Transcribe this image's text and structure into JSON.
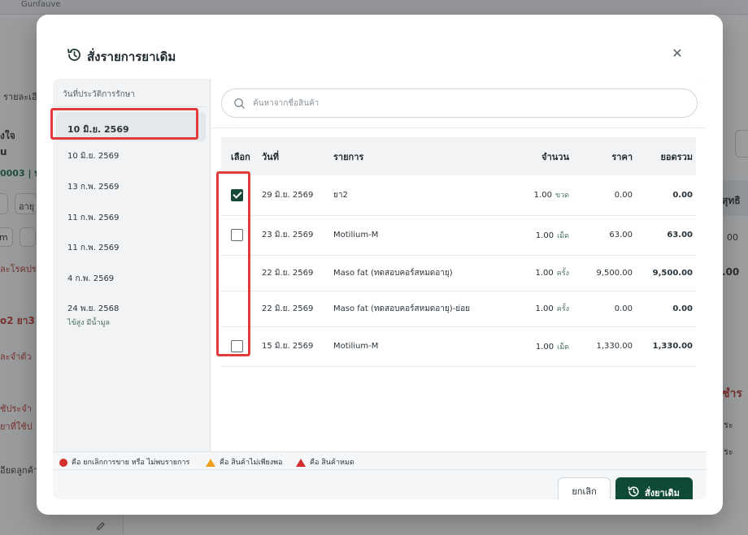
{
  "background": {
    "top_text": "Gunfauve",
    "left_fragments": [
      "รายละเอี",
      "งใจ",
      "u",
      "0003 | ท",
      "อายุ",
      "m",
      "ละโรคประ",
      "o2 ยา3",
      "ละจำตัว",
      "ชัประจำ",
      "ยาที่ใช้ป",
      "อียดลูกค้า"
    ],
    "right_fragments": [
      "สุทธิ",
      "00",
      ".00",
      "ชำร",
      "ระ",
      "ระ"
    ]
  },
  "modal": {
    "title": "สั่งรายการยาเดิม",
    "title_icon": "history-icon",
    "close_icon": "close-icon",
    "close_glyph": "✕"
  },
  "history_panel": {
    "title": "วันที่ประวัติการรักษา",
    "items": [
      {
        "date": "10 มิ.ย. 2569",
        "note": "",
        "active": true
      },
      {
        "date": "10 มิ.ย. 2569",
        "note": "",
        "active": false
      },
      {
        "date": "13 ก.พ. 2569",
        "note": "",
        "active": false
      },
      {
        "date": "11 ก.พ. 2569",
        "note": "",
        "active": false
      },
      {
        "date": "11 ก.พ. 2569",
        "note": "",
        "active": false
      },
      {
        "date": "4 ก.พ. 2569",
        "note": "",
        "active": false
      },
      {
        "date": "24 พ.ย. 2568",
        "note": "ไข้สูง มีน้ำมูล",
        "active": false
      }
    ]
  },
  "search": {
    "placeholder": "ค้นหาจากชื่อสินค้า",
    "value": ""
  },
  "table": {
    "headers": {
      "select": "เลือก",
      "date": "วันที่",
      "item": "รายการ",
      "qty": "จำนวน",
      "price": "ราคา",
      "total": "ยอดรวม"
    },
    "rows": [
      {
        "checkbox": "checked",
        "date": "29 มิ.ย. 2569",
        "item": "ยา2",
        "qty": "1.00",
        "unit": "ขวด",
        "price": "0.00",
        "total": "0.00"
      },
      {
        "checkbox": "unchecked",
        "date": "23 มิ.ย. 2569",
        "item": "Motilium-M",
        "qty": "1.00",
        "unit": "เม็ด",
        "price": "63.00",
        "total": "63.00"
      },
      {
        "checkbox": "none",
        "date": "22 มิ.ย. 2569",
        "item": "Maso fat (ทดสอบคอร์สหมดอายุ)",
        "qty": "1.00",
        "unit": "ครั้ง",
        "price": "9,500.00",
        "total": "9,500.00"
      },
      {
        "checkbox": "none",
        "date": "22 มิ.ย. 2569",
        "item": "Maso fat (ทดสอบคอร์สหมดอายุ)-ย่อย",
        "qty": "1.00",
        "unit": "ครั้ง",
        "price": "0.00",
        "total": "0.00"
      },
      {
        "checkbox": "unchecked",
        "date": "15 มิ.ย. 2569",
        "item": "Motilium-M",
        "qty": "1.00",
        "unit": "เม็ด",
        "price": "1,330.00",
        "total": "1,330.00"
      }
    ]
  },
  "legend": [
    {
      "icon": "red-circle-icon",
      "color": "#d32f2f",
      "text": "คือ ยกเลิกการขาย หรือ ไม่พบรายการ"
    },
    {
      "icon": "orange-triangle-icon",
      "color": "#f0a020",
      "text": "คือ สินค้าไม่เพียงพอ"
    },
    {
      "icon": "red-triangle-icon",
      "color": "#d32f2f",
      "text": "คือ สินค้าหมด"
    }
  ],
  "footer": {
    "cancel_label": "ยกเลิก",
    "reorder_label": "สั่งยาเดิม",
    "reorder_icon": "history-icon"
  },
  "colors": {
    "primary": "#0f4a38",
    "checkbox_checked": "#17493a",
    "annotation": "#e23b3b"
  }
}
